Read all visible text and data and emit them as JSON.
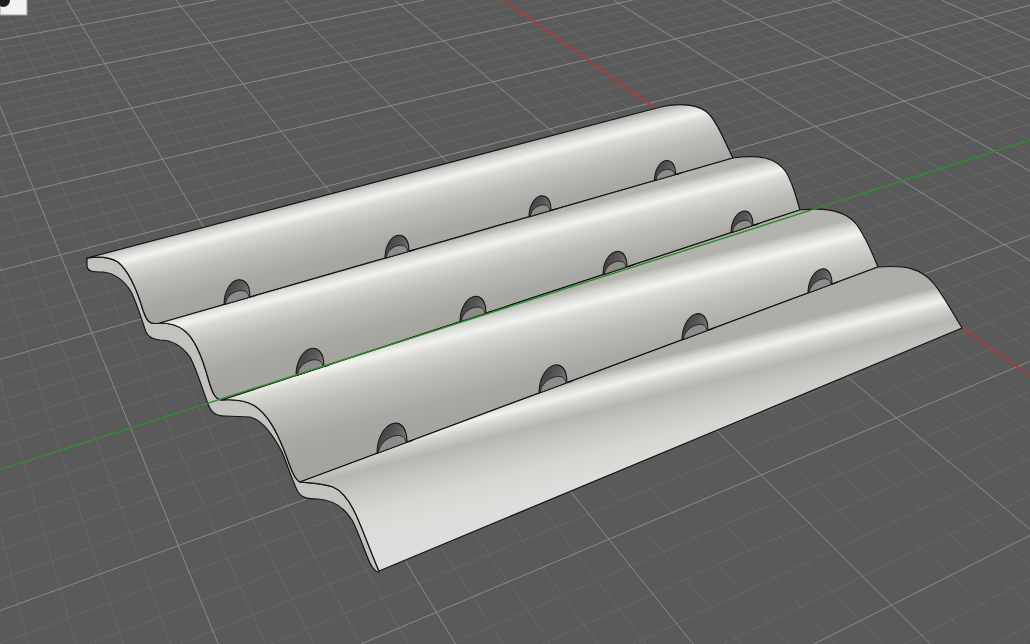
{
  "viewport": {
    "axes": [
      {
        "kind": "x",
        "color": "#b83232"
      },
      {
        "kind": "y",
        "color": "#2b8a2b"
      }
    ]
  }
}
